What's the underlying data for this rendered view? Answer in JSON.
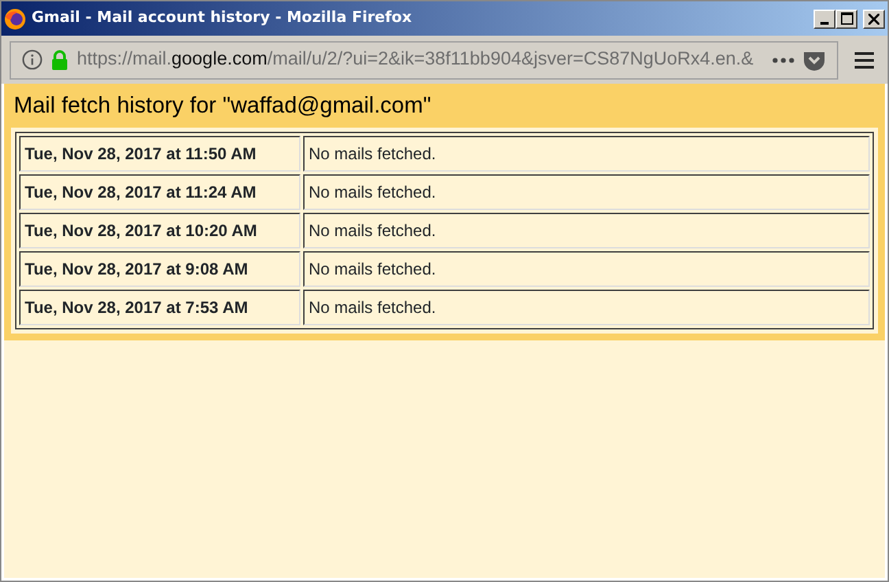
{
  "window": {
    "title": "Gmail - Mail account history - Mozilla Firefox"
  },
  "address_bar": {
    "url_start": "https://mail.",
    "url_domain": "google.com",
    "url_end": "/mail/u/2/?ui=2&ik=38f11bb904&jsver=CS87NgUoRx4.en.&"
  },
  "heading": "Mail fetch history for \"waffad@gmail.com\"",
  "rows": [
    {
      "time": "Tue, Nov 28, 2017 at 11:50 AM",
      "result": "No mails fetched."
    },
    {
      "time": "Tue, Nov 28, 2017 at 11:24 AM",
      "result": "No mails fetched."
    },
    {
      "time": "Tue, Nov 28, 2017 at 10:20 AM",
      "result": "No mails fetched."
    },
    {
      "time": "Tue, Nov 28, 2017 at 9:08 AM",
      "result": "No mails fetched."
    },
    {
      "time": "Tue, Nov 28, 2017 at 7:53 AM",
      "result": "No mails fetched."
    }
  ]
}
